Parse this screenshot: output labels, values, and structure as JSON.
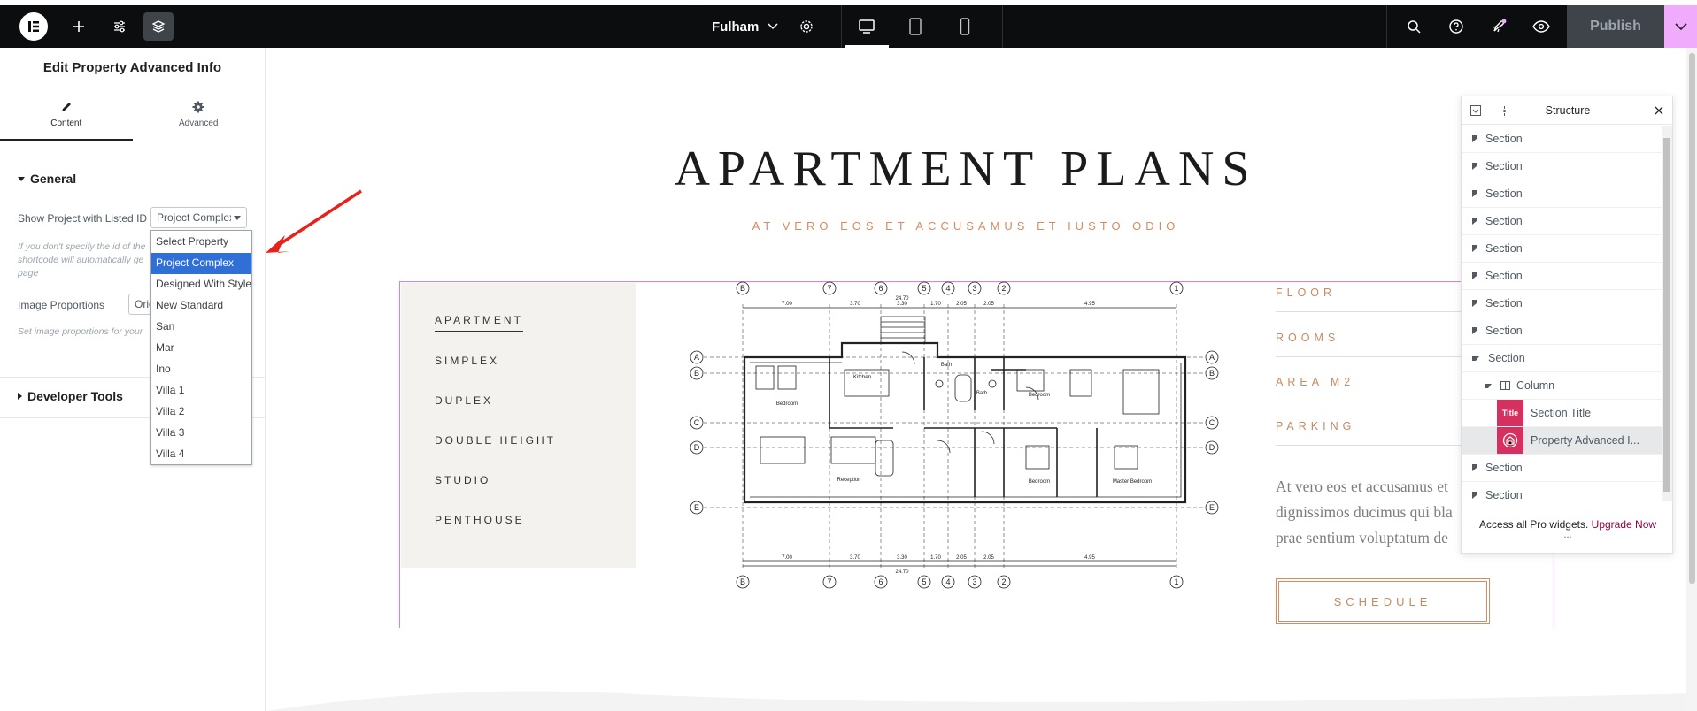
{
  "topbar": {
    "site_name": "Fulham",
    "publish_label": "Publish",
    "icons": [
      "elementor-logo-icon",
      "plus-icon",
      "sliders-icon",
      "layers-icon",
      "chevron-down-icon",
      "gear-icon",
      "desktop-icon",
      "tablet-icon",
      "mobile-icon",
      "search-icon",
      "help-icon",
      "rocket-icon",
      "eye-icon"
    ]
  },
  "panel": {
    "title": "Edit Property Advanced Info",
    "tabs": [
      {
        "label": "Content",
        "icon": "pencil-icon"
      },
      {
        "label": "Advanced",
        "icon": "gear-icon"
      }
    ],
    "general_label": "General",
    "show_project_label": "Show Project with Listed ID",
    "show_project_value": "Project Complex",
    "help_text_1": "If you don't specify the id of the",
    "help_text_2": "shortcode will automatically ge",
    "help_text_3": "page",
    "image_proportions_label": "Image Proportions",
    "image_proportions_value": "Orig",
    "image_proportions_help": "Set image proportions for your",
    "developer_tools_label": "Developer Tools",
    "dropdown_options": [
      "Select Property",
      "Project Complex",
      "Designed With Style",
      "New Standard",
      "San",
      "Mar",
      "Ino",
      "Villa 1",
      "Villa 2",
      "Villa 3",
      "Villa 4"
    ],
    "dropdown_selected_index": 1
  },
  "canvas": {
    "title": "APARTMENT PLANS",
    "subtitle": "AT VERO EOS ET ACCUSAMUS ET IUSTO ODIO",
    "types": [
      "APARTMENT",
      "SIMPLEX",
      "DUPLEX",
      "DOUBLE HEIGHT",
      "STUDIO",
      "PENTHOUSE"
    ],
    "specs": [
      "FLOOR",
      "ROOMS",
      "AREA M2",
      "PARKING"
    ],
    "description_lines": [
      "At vero eos et accusamus et",
      "dignissimos ducimus qui bla",
      "prae sentium voluptatum de"
    ],
    "schedule_label": "SCHEDULE",
    "plan_room_labels": [
      "Kitchen",
      "Bath",
      "Bath",
      "Bedroom",
      "Bedroom",
      "Reception",
      "Bedroom",
      "Master Bedroom"
    ],
    "plan_dimensions_top": [
      "7.00",
      "3.70",
      "3.30",
      "1.70",
      "2.05",
      "2.05",
      "4.95"
    ],
    "plan_total": "24.70",
    "plan_axis_top": [
      "B",
      "7",
      "6",
      "5",
      "4",
      "3",
      "2",
      "1"
    ],
    "plan_axis_side": [
      "A",
      "B",
      "C",
      "D",
      "E"
    ]
  },
  "structure": {
    "title": "Structure",
    "rows": [
      {
        "label": "Section",
        "type": "section"
      },
      {
        "label": "Section",
        "type": "section"
      },
      {
        "label": "Section",
        "type": "section"
      },
      {
        "label": "Section",
        "type": "section"
      },
      {
        "label": "Section",
        "type": "section"
      },
      {
        "label": "Section",
        "type": "section"
      },
      {
        "label": "Section",
        "type": "section"
      },
      {
        "label": "Section",
        "type": "section"
      },
      {
        "label": "Section",
        "type": "section-open"
      },
      {
        "label": "Column",
        "type": "column"
      },
      {
        "label": "Section Title",
        "type": "widget",
        "badge": "Title"
      },
      {
        "label": "Property Advanced I...",
        "type": "widget-active"
      },
      {
        "label": "Section",
        "type": "section"
      },
      {
        "label": "Section",
        "type": "section"
      }
    ],
    "footer_text": "Access all Pro widgets.",
    "upgrade_label": "Upgrade Now",
    "more": "..."
  }
}
